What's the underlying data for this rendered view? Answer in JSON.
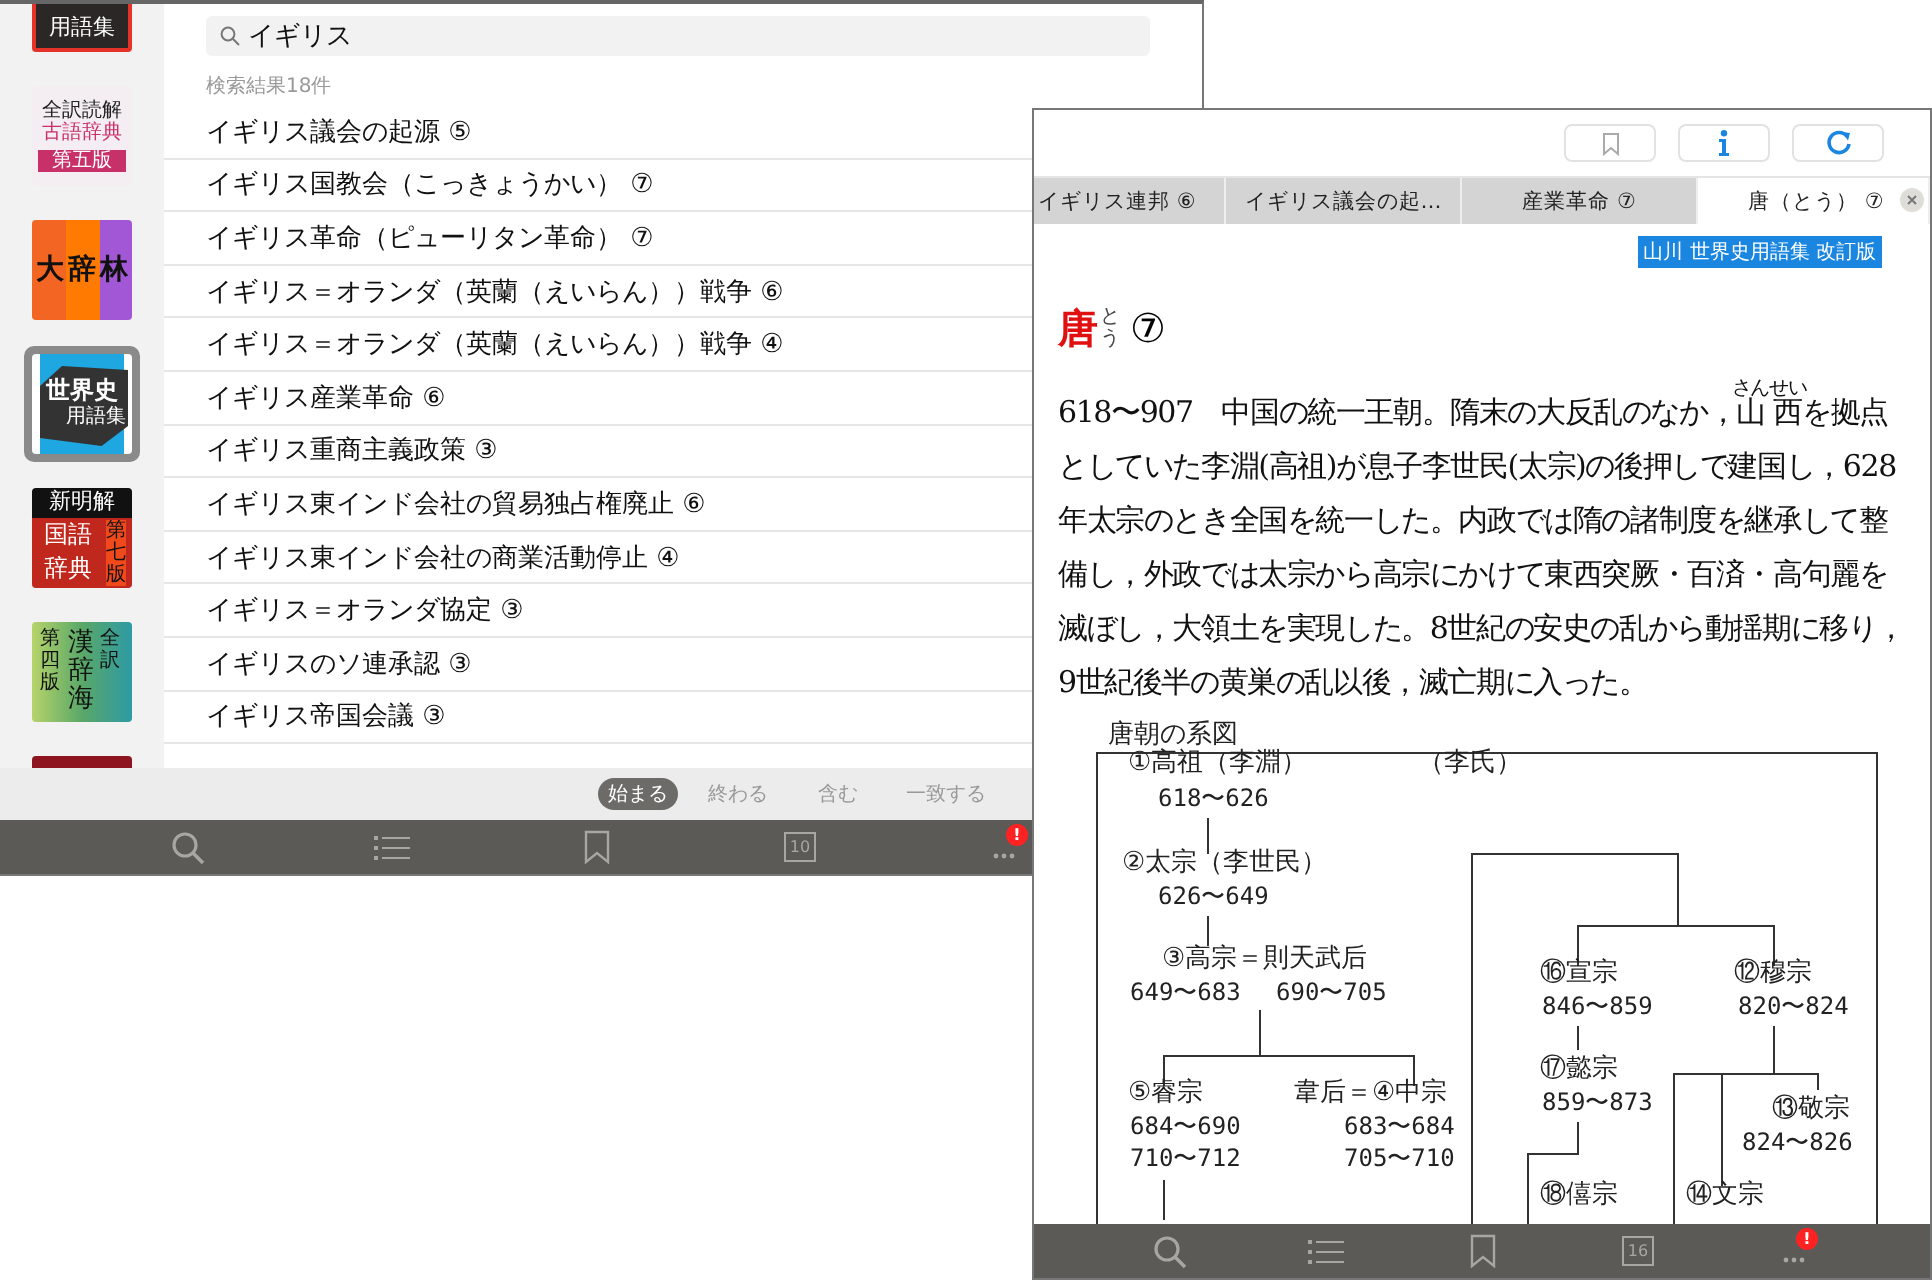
{
  "left_window": {
    "sidebar": {
      "items": [
        {
          "kind": "yogoshu",
          "lines": [
            "用語集"
          ],
          "selected": false
        },
        {
          "kind": "kogo",
          "lines": [
            "全訳読解",
            "古語辞典",
            "第五版"
          ],
          "selected": false
        },
        {
          "kind": "daijirin",
          "lines": [
            "大辞林"
          ],
          "selected": false
        },
        {
          "kind": "sekaishi",
          "lines": [
            "世界史",
            "用語集"
          ],
          "selected": true
        },
        {
          "kind": "shinmeikai",
          "lines": [
            "新明解",
            "国語",
            "辞典",
            "第七版"
          ],
          "selected": false
        },
        {
          "kind": "kanjikai",
          "lines": [
            "第四版",
            "漢辞海",
            "全訳"
          ],
          "selected": false
        },
        {
          "kind": "plain",
          "selected": false
        }
      ]
    },
    "search": {
      "value": "イギリス"
    },
    "result_count": "検索結果18件",
    "results": [
      "イギリス議会の起源 ⑤",
      "イギリス国教会（こっきょうかい） ⑦",
      "イギリス革命（ピューリタン革命） ⑦",
      "イギリス＝オランダ（英蘭（えいらん））戦争 ⑥",
      "イギリス＝オランダ（英蘭（えいらん））戦争 ④",
      "イギリス産業革命 ⑥",
      "イギリス重商主義政策 ③",
      "イギリス東インド会社の貿易独占権廃止 ⑥",
      "イギリス東インド会社の商業活動停止 ④",
      "イギリス＝オランダ協定 ③",
      "イギリスのソ連承認 ③",
      "イギリス帝国会議 ③"
    ],
    "filters": [
      {
        "label": "始まる",
        "selected": true
      },
      {
        "label": "終わる",
        "selected": false
      },
      {
        "label": "含む",
        "selected": false
      },
      {
        "label": "一致する",
        "selected": false
      }
    ],
    "tab_bar": {
      "page_count": "10",
      "badge": "!"
    }
  },
  "right_window": {
    "tabs": [
      {
        "label": "イギリス連邦 ⑥",
        "selected": false
      },
      {
        "label": "イギリス議会の起…",
        "selected": false
      },
      {
        "label": "産業革命 ⑦",
        "selected": false
      },
      {
        "label": "唐（とう） ⑦",
        "selected": true
      }
    ],
    "source_badge": "山川 世界史用語集 改訂版",
    "headword": {
      "text": "唐",
      "ruby": "とう",
      "number": "⑦"
    },
    "body": [
      {
        "text": "618〜907　中国の統一王朝。隋末の大反乱のなか，"
      },
      {
        "text": "山西",
        "ruby": "さんせい"
      },
      {
        "text": "を拠点としていた李淵(高祖)が息子李世民(太宗)の後押しで建国し，628年太宗のとき全国を統一した。内政では隋の諸制度を継承して整備し，外政では太宗から高宗にかけて東西突厥・百済・高句麗を滅ぼし，大領土を実現した。8世紀の安史の乱から動揺期に移り，9世紀後半の黄巣の乱以後，滅亡期に入った。"
      }
    ],
    "figure": {
      "title": "唐朝の系図",
      "clan": "（李氏）",
      "nodes": [
        {
          "name": "①高祖（李淵）",
          "years": [
            "618〜626"
          ]
        },
        {
          "name": "②太宗（李世民）",
          "years": [
            "626〜649"
          ]
        },
        {
          "name": "③高宗＝則天武后",
          "years": [
            "649〜683",
            "690〜705"
          ]
        },
        {
          "name": "⑤睿宗",
          "years": [
            "684〜690",
            "710〜712"
          ]
        },
        {
          "name": "韋后＝④中宗",
          "years": [
            "683〜684",
            "705〜710"
          ]
        },
        {
          "name": "⑯宣宗",
          "years": [
            "846〜859"
          ]
        },
        {
          "name": "⑫穆宗",
          "years": [
            "820〜824"
          ]
        },
        {
          "name": "⑰懿宗",
          "years": [
            "859〜873"
          ]
        },
        {
          "name": "⑬敬宗",
          "years": [
            "824〜826"
          ]
        },
        {
          "name": "⑱僖宗"
        },
        {
          "name": "⑭文宗"
        }
      ]
    },
    "tab_bar": {
      "page_count": "16",
      "badge": "!"
    }
  }
}
